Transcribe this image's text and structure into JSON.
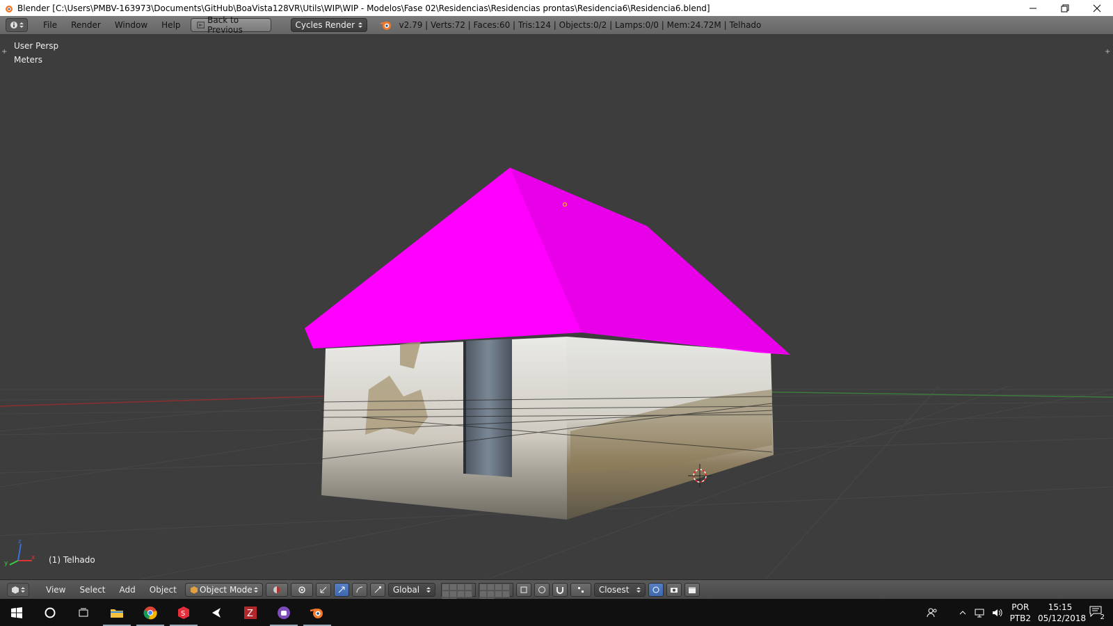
{
  "window": {
    "title": "Blender [C:\\Users\\PMBV-163973\\Documents\\GitHub\\BoaVista128VR\\Utils\\WIP\\WIP - Modelos\\Fase 02\\Residencias\\Residencias prontas\\Residencia6\\Residencia6.blend]"
  },
  "info_header": {
    "menus": [
      "File",
      "Render",
      "Window",
      "Help"
    ],
    "back_button": "Back to Previous",
    "render_engine": "Cycles Render",
    "stats": "v2.79 | Verts:72 | Faces:60 | Tris:124 | Objects:0/2 | Lamps:0/0 | Mem:24.72M | Telhado"
  },
  "viewport": {
    "view_name": "User Persp",
    "units": "Meters",
    "active_object": "(1) Telhado",
    "colors": {
      "roof": "#ff00ff",
      "background": "#3d3d3d"
    }
  },
  "view3d_header": {
    "menus": [
      "View",
      "Select",
      "Add",
      "Object"
    ],
    "mode": "Object Mode",
    "orientation": "Global",
    "snap_target": "Closest"
  },
  "taskbar": {
    "apps": [
      "start-icon",
      "cortana-icon",
      "task-view-icon",
      "file-explorer-icon",
      "chrome-icon",
      "sourcetree-icon",
      "unity-icon",
      "filezilla-icon",
      "app-icon",
      "blender-icon"
    ],
    "language_top": "POR",
    "language_bottom": "PTB2",
    "time": "15:15",
    "date": "05/12/2018",
    "notifications": "2"
  }
}
